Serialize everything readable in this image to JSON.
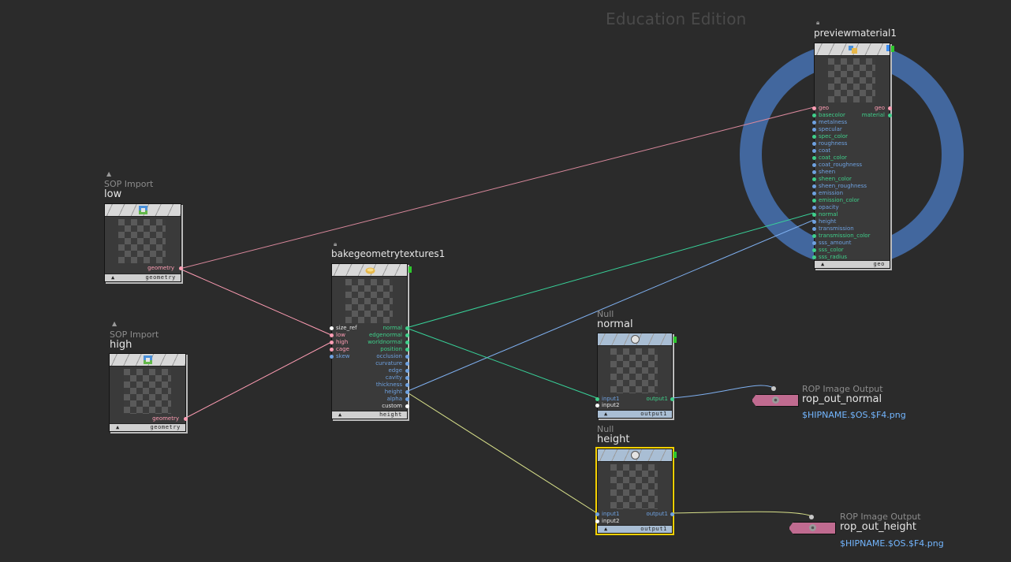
{
  "watermark": "Education Edition",
  "colors": {
    "background": "#2b2b2b",
    "geometry_wire": "#ff9db4",
    "normal_wire": "#38d39a",
    "height_wire": "#7fb0f0",
    "height_out_wire": "#d8e08a",
    "float_port": "#6ea1e0",
    "vector_port": "#3fcf8a",
    "selection": "#f4d000",
    "ring": "#42679e",
    "display_flag": "#2ec82e",
    "rop_node": "#c06b90"
  },
  "nodes": {
    "low": {
      "type": "SOP Import",
      "name": "low",
      "icon": "sop-import-icon",
      "output": "geometry",
      "footer": "geometry"
    },
    "high": {
      "type": "SOP Import",
      "name": "high",
      "icon": "sop-import-icon",
      "output": "geometry",
      "footer": "geometry"
    },
    "bake": {
      "name": "bakegeometrytextures1",
      "icon": "bake-icon",
      "footer": "height",
      "inputs": [
        "size_ref",
        "low",
        "high",
        "cage",
        "skew"
      ],
      "outputs": [
        "normal",
        "edgenormal",
        "worldnormal",
        "position",
        "occlusion",
        "curvature",
        "edge",
        "cavity",
        "thickness",
        "height",
        "alpha",
        "custom"
      ]
    },
    "preview": {
      "name": "previewmaterial1",
      "icon": "material-icon",
      "footer": "geo",
      "inputs": [
        "geo",
        "basecolor",
        "metalness",
        "specular",
        "spec_color",
        "roughness",
        "coat",
        "coat_color",
        "coat_roughness",
        "sheen",
        "sheen_color",
        "sheen_roughness",
        "emission",
        "emission_color",
        "opacity",
        "normal",
        "height",
        "transmission",
        "transmission_color",
        "sss_amount",
        "sss_color",
        "sss_radius"
      ],
      "outputs": [
        "geo",
        "material"
      ]
    },
    "null_normal": {
      "type": "Null",
      "name": "normal",
      "icon": "null-circle-icon",
      "inputs": [
        "input1",
        "input2"
      ],
      "output": "output1",
      "footer": "output1"
    },
    "null_height": {
      "type": "Null",
      "name": "height",
      "icon": "null-circle-icon",
      "inputs": [
        "input1",
        "input2"
      ],
      "output": "output1",
      "footer": "output1"
    },
    "rop_normal": {
      "type": "ROP Image Output",
      "name": "rop_out_normal",
      "file": "$HIPNAME.$OS.$F4.png",
      "icon": "gear-icon"
    },
    "rop_height": {
      "type": "ROP Image Output",
      "name": "rop_out_height",
      "file": "$HIPNAME.$OS.$F4.png",
      "icon": "gear-icon"
    }
  }
}
